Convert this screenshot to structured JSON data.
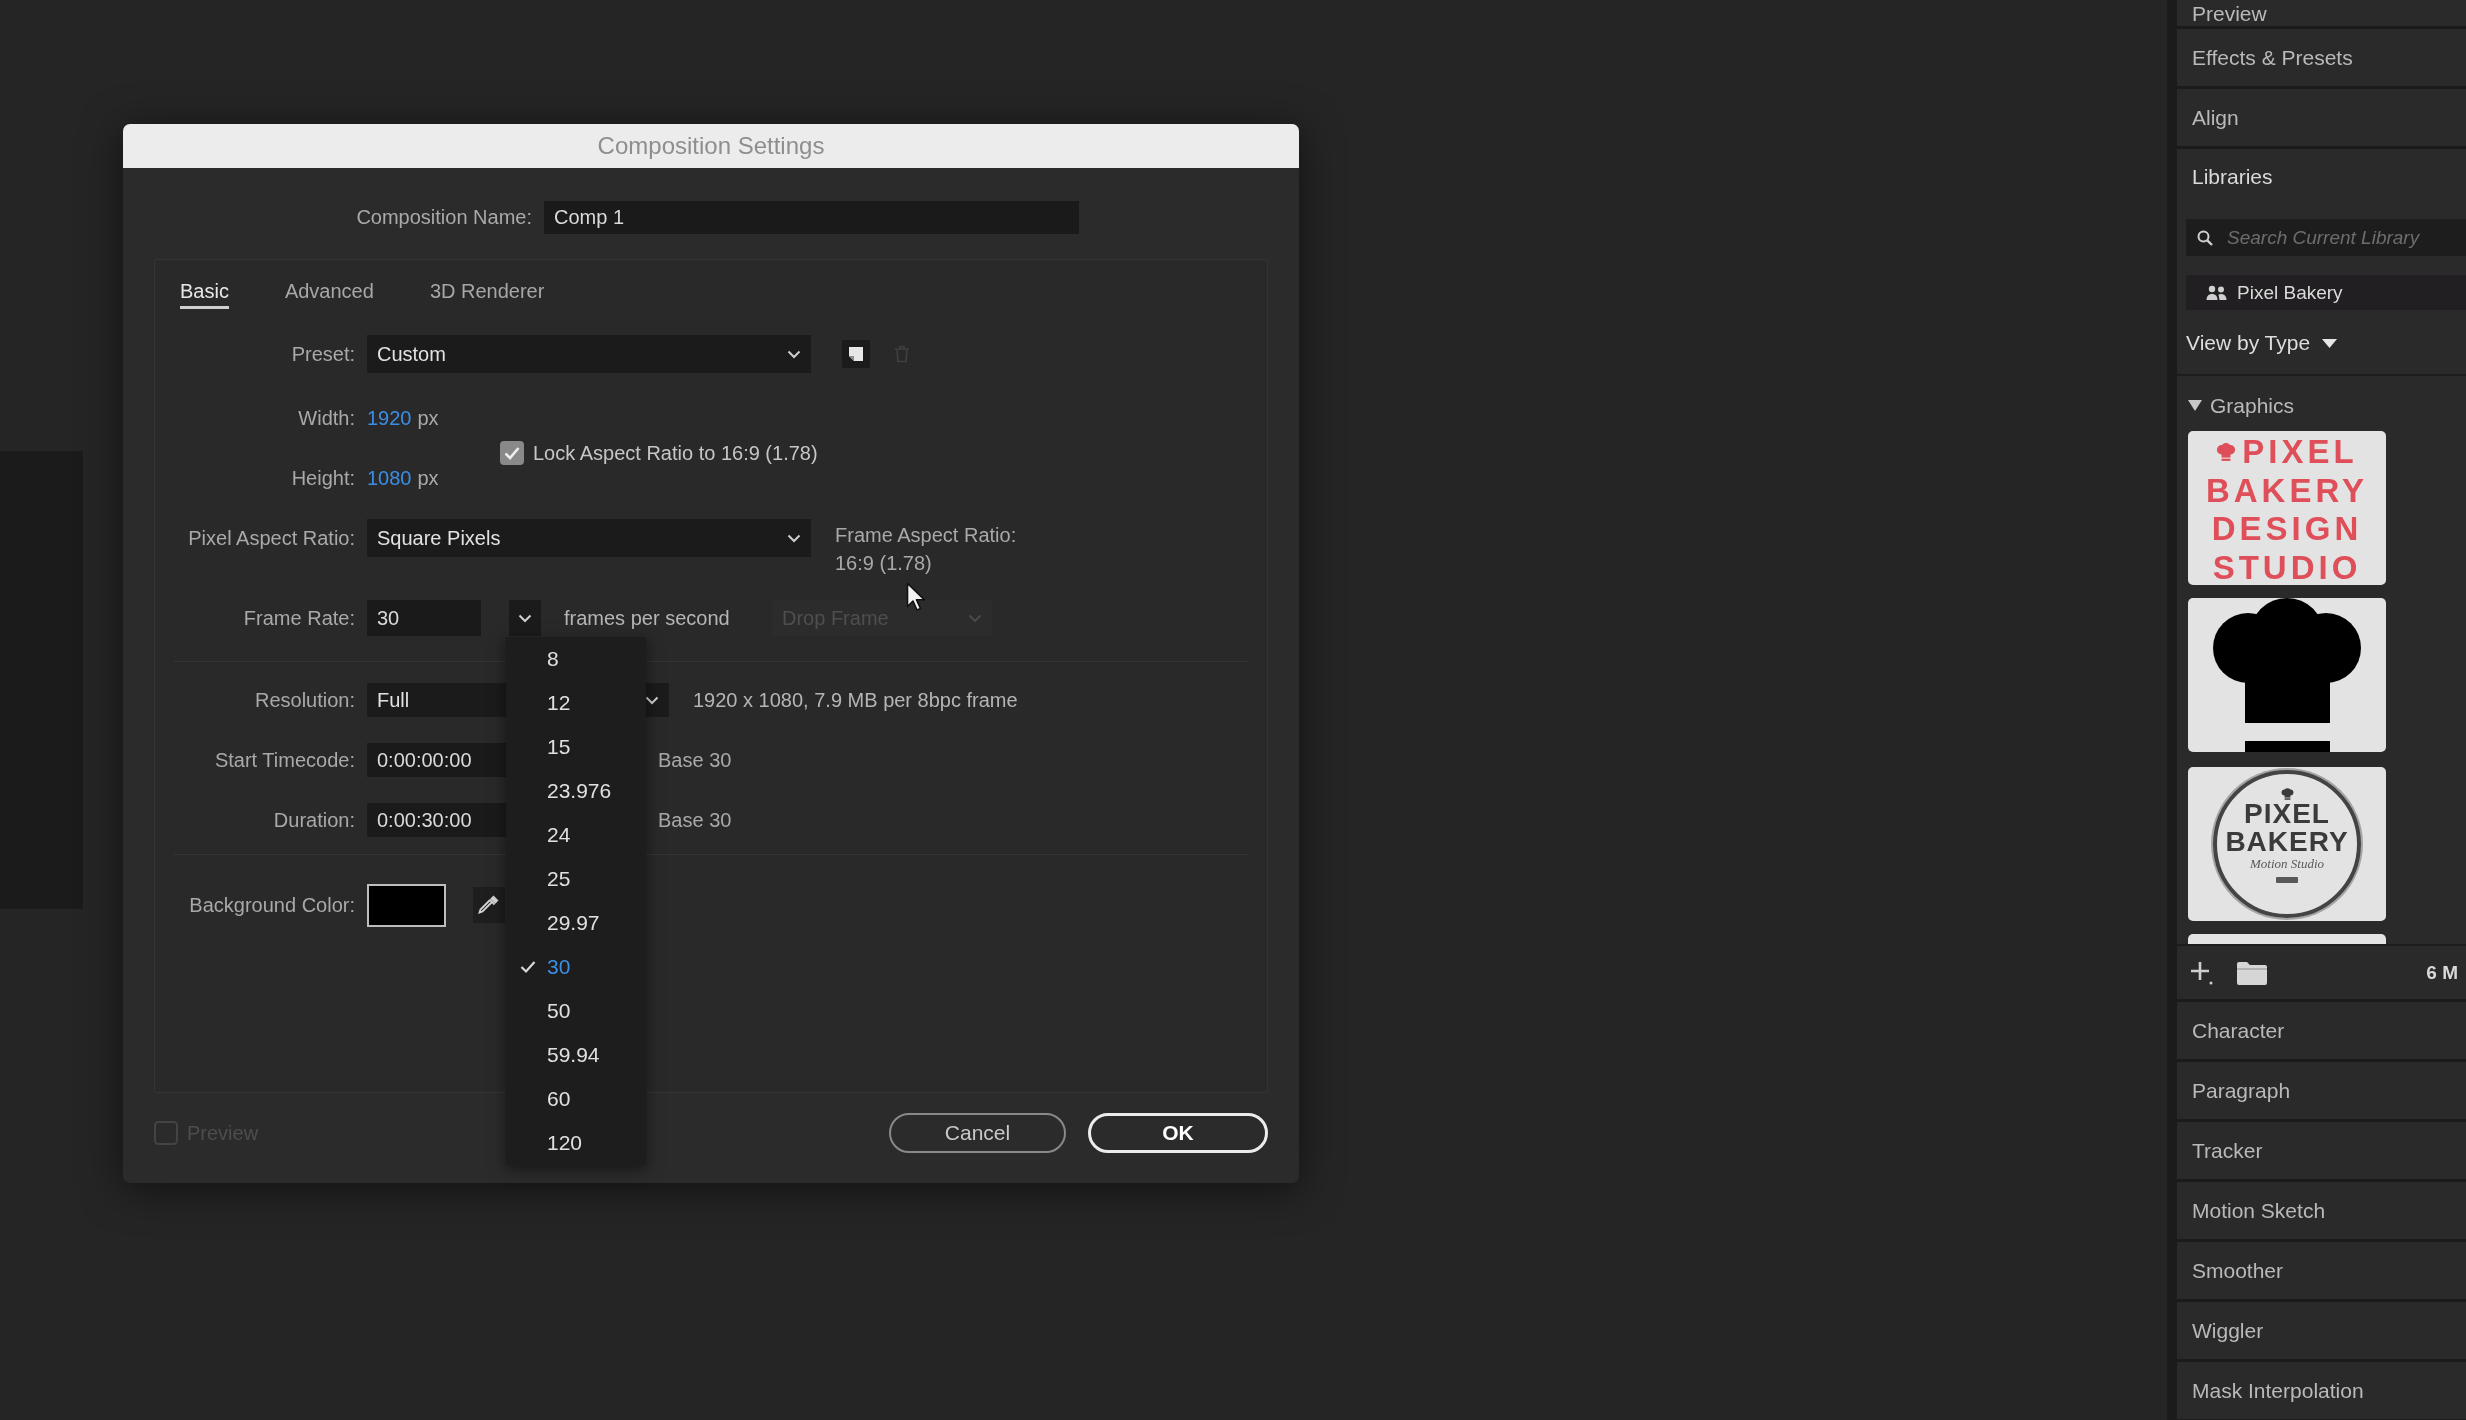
{
  "dialog": {
    "title": "Composition Settings",
    "composition_name": {
      "label": "Composition Name:",
      "value": "Comp 1"
    },
    "tabs": [
      {
        "label": "Basic",
        "selected": true
      },
      {
        "label": "Advanced",
        "selected": false
      },
      {
        "label": "3D Renderer",
        "selected": false
      }
    ],
    "preset": {
      "label": "Preset:",
      "value": "Custom",
      "buttons": [
        {
          "kind": "save",
          "disabled": false
        },
        {
          "kind": "delete",
          "disabled": true
        }
      ]
    },
    "width": {
      "label": "Width:",
      "value": "1920",
      "unit": "px"
    },
    "height": {
      "label": "Height:",
      "value": "1080",
      "unit": "px"
    },
    "lock_aspect_ratio": {
      "label": "Lock Aspect Ratio to 16:9 (1.78)",
      "checked": true
    },
    "pixel_aspect_ratio": {
      "label": "Pixel Aspect Ratio:",
      "value": "Square Pixels"
    },
    "frame_aspect_ratio": {
      "label": "Frame Aspect Ratio:",
      "value": "16:9 (1.78)"
    },
    "frame_rate": {
      "label": "Frame Rate:",
      "value": "30",
      "unit": "frames per second",
      "drop_frame": {
        "value": "Drop Frame",
        "disabled": true
      }
    },
    "resolution": {
      "label": "Resolution:",
      "value": "Full",
      "info": "1920 x 1080, 7.9 MB per 8bpc frame"
    },
    "start_timecode": {
      "label": "Start Timecode:",
      "value": "0:00:00:00",
      "base": "Base 30"
    },
    "duration": {
      "label": "Duration:",
      "value": "0:00:30:00",
      "base": "Base 30"
    },
    "background_color": {
      "label": "Background Color:",
      "color": "#000000"
    },
    "preview": {
      "label": "Preview",
      "checked": false,
      "disabled": true
    },
    "buttons": [
      {
        "label": "Cancel",
        "default": false
      },
      {
        "label": "OK",
        "default": true
      }
    ]
  },
  "frame_rate_menu": [
    {
      "label": "8",
      "selected": false
    },
    {
      "label": "12",
      "selected": false
    },
    {
      "label": "15",
      "selected": false
    },
    {
      "label": "23.976",
      "selected": false
    },
    {
      "label": "24",
      "selected": false
    },
    {
      "label": "25",
      "selected": false
    },
    {
      "label": "29.97",
      "selected": false
    },
    {
      "label": "30",
      "selected": true
    },
    {
      "label": "50",
      "selected": false
    },
    {
      "label": "59.94",
      "selected": false
    },
    {
      "label": "60",
      "selected": false
    },
    {
      "label": "120",
      "selected": false
    }
  ],
  "panels": {
    "top": [
      {
        "label": "Preview"
      },
      {
        "label": "Effects & Presets"
      },
      {
        "label": "Align"
      }
    ],
    "libraries": {
      "title": "Libraries",
      "search": {
        "placeholder": "Search Current Library"
      },
      "library": "Pixel Bakery",
      "view": "View by Type",
      "group": {
        "label": "Graphics",
        "expanded": true,
        "items": [
          {
            "kind": "wordmark",
            "lines": [
              "PIXEL",
              "BAKERY",
              "DESIGN",
              "STUDIO"
            ]
          },
          {
            "kind": "hat"
          },
          {
            "kind": "seal",
            "lines": [
              "PIXEL",
              "BAKERY"
            ],
            "script": "Motion Studio"
          },
          {
            "kind": "partial"
          }
        ]
      },
      "storage": "6 M"
    },
    "bottom": [
      {
        "label": "Character"
      },
      {
        "label": "Paragraph"
      },
      {
        "label": "Tracker"
      },
      {
        "label": "Motion Sketch"
      },
      {
        "label": "Smoother"
      },
      {
        "label": "Wiggler"
      },
      {
        "label": "Mask Interpolation"
      }
    ]
  }
}
